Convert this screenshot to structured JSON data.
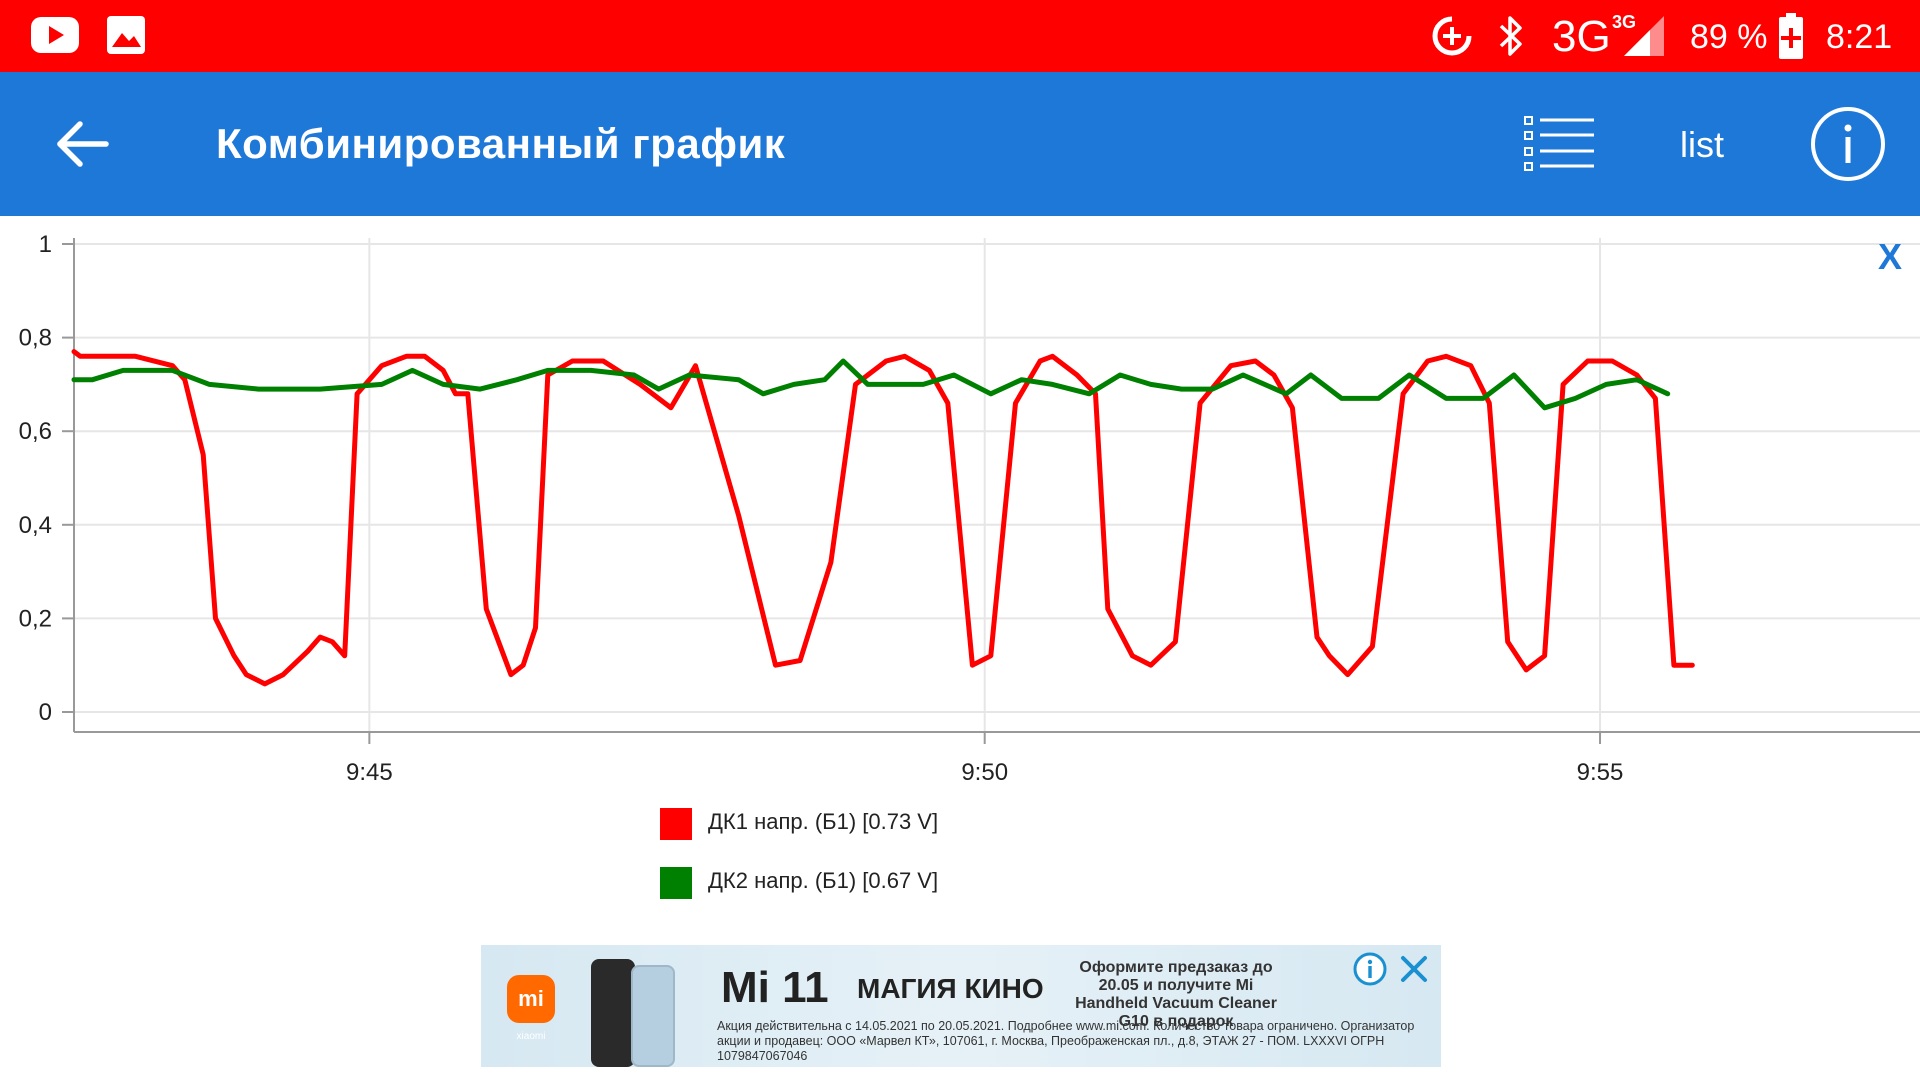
{
  "status_bar": {
    "network": "3G",
    "network_super": "3G",
    "battery_percent": "89 %",
    "time": "8:21",
    "icons": [
      "youtube-icon",
      "gallery-icon",
      "data-saver-icon",
      "bluetooth-icon",
      "signal-icon",
      "battery-charging-icon"
    ]
  },
  "app_bar": {
    "title": "Комбинированный график",
    "list_label": "list",
    "icons": [
      "back-arrow-icon",
      "list-icon",
      "info-icon"
    ]
  },
  "close_label": "X",
  "colors": {
    "status_bar": "#ff0000",
    "app_bar": "#1e78d8",
    "series1": "#ff0000",
    "series2": "#008000"
  },
  "chart_data": {
    "type": "line",
    "title": "",
    "xlabel": "",
    "ylabel": "",
    "xlim": [
      "9:42.6",
      "9:57.6"
    ],
    "ylim": [
      0,
      1
    ],
    "yticks": [
      "0",
      "0,2",
      "0,4",
      "0,6",
      "0,8",
      "1"
    ],
    "xticks": [
      "9:45",
      "9:50",
      "9:55"
    ],
    "grid": true,
    "legend_position": "bottom",
    "series": [
      {
        "name": "ДК1 напр. (Б1) [0.73 V]",
        "color": "#ff0000",
        "points": [
          [
            "9:42.6",
            0.77
          ],
          [
            "9:42.65",
            0.76
          ],
          [
            "9:43.1",
            0.76
          ],
          [
            "9:43.4",
            0.74
          ],
          [
            "9:43.5",
            0.71
          ],
          [
            "9:43.65",
            0.55
          ],
          [
            "9:43.75",
            0.2
          ],
          [
            "9:43.9",
            0.12
          ],
          [
            "9:44.0",
            0.08
          ],
          [
            "9:44.15",
            0.06
          ],
          [
            "9:44.3",
            0.08
          ],
          [
            "9:44.5",
            0.13
          ],
          [
            "9:44.6",
            0.16
          ],
          [
            "9:44.7",
            0.15
          ],
          [
            "9:44.8",
            0.12
          ],
          [
            "9:44.9",
            0.68
          ],
          [
            "9:45.1",
            0.74
          ],
          [
            "9:45.3",
            0.76
          ],
          [
            "9:45.45",
            0.76
          ],
          [
            "9:45.6",
            0.73
          ],
          [
            "9:45.7",
            0.68
          ],
          [
            "9:45.8",
            0.68
          ],
          [
            "9:45.95",
            0.22
          ],
          [
            "9:46.15",
            0.08
          ],
          [
            "9:46.25",
            0.1
          ],
          [
            "9:46.35",
            0.18
          ],
          [
            "9:46.45",
            0.72
          ],
          [
            "9:46.65",
            0.75
          ],
          [
            "9:46.9",
            0.75
          ],
          [
            "9:47.2",
            0.7
          ],
          [
            "9:47.45",
            0.65
          ],
          [
            "9:47.65",
            0.74
          ],
          [
            "9:48.0",
            0.42
          ],
          [
            "9:48.3",
            0.1
          ],
          [
            "9:48.5",
            0.11
          ],
          [
            "9:48.75",
            0.32
          ],
          [
            "9:48.95",
            0.7
          ],
          [
            "9:49.2",
            0.75
          ],
          [
            "9:49.35",
            0.76
          ],
          [
            "9:49.55",
            0.73
          ],
          [
            "9:49.7",
            0.66
          ],
          [
            "9:49.9",
            0.1
          ],
          [
            "9:50.05",
            0.12
          ],
          [
            "9:50.25",
            0.66
          ],
          [
            "9:50.45",
            0.75
          ],
          [
            "9:50.55",
            0.76
          ],
          [
            "9:50.75",
            0.72
          ],
          [
            "9:50.9",
            0.68
          ],
          [
            "9:51.0",
            0.22
          ],
          [
            "9:51.2",
            0.12
          ],
          [
            "9:51.35",
            0.1
          ],
          [
            "9:51.55",
            0.15
          ],
          [
            "9:51.75",
            0.66
          ],
          [
            "9:52.0",
            0.74
          ],
          [
            "9:52.2",
            0.75
          ],
          [
            "9:52.35",
            0.72
          ],
          [
            "9:52.5",
            0.65
          ],
          [
            "9:52.7",
            0.16
          ],
          [
            "9:52.8",
            0.12
          ],
          [
            "9:52.95",
            0.08
          ],
          [
            "9:53.15",
            0.14
          ],
          [
            "9:53.4",
            0.68
          ],
          [
            "9:53.6",
            0.75
          ],
          [
            "9:53.75",
            0.76
          ],
          [
            "9:53.95",
            0.74
          ],
          [
            "9:54.1",
            0.66
          ],
          [
            "9:54.25",
            0.15
          ],
          [
            "9:54.4",
            0.09
          ],
          [
            "9:54.55",
            0.12
          ],
          [
            "9:54.7",
            0.7
          ],
          [
            "9:54.9",
            0.75
          ],
          [
            "9:55.1",
            0.75
          ],
          [
            "9:55.3",
            0.72
          ],
          [
            "9:55.45",
            0.67
          ],
          [
            "9:55.6",
            0.1
          ],
          [
            "9:55.75",
            0.1
          ]
        ]
      },
      {
        "name": "ДК2 напр. (Б1) [0.67 V]",
        "color": "#008000",
        "points": [
          [
            "9:42.6",
            0.71
          ],
          [
            "9:42.75",
            0.71
          ],
          [
            "9:43.0",
            0.73
          ],
          [
            "9:43.4",
            0.73
          ],
          [
            "9:43.7",
            0.7
          ],
          [
            "9:44.1",
            0.69
          ],
          [
            "9:44.6",
            0.69
          ],
          [
            "9:45.1",
            0.7
          ],
          [
            "9:45.35",
            0.73
          ],
          [
            "9:45.6",
            0.7
          ],
          [
            "9:45.9",
            0.69
          ],
          [
            "9:46.2",
            0.71
          ],
          [
            "9:46.45",
            0.73
          ],
          [
            "9:46.8",
            0.73
          ],
          [
            "9:47.15",
            0.72
          ],
          [
            "9:47.35",
            0.69
          ],
          [
            "9:47.6",
            0.72
          ],
          [
            "9:48.0",
            0.71
          ],
          [
            "9:48.2",
            0.68
          ],
          [
            "9:48.45",
            0.7
          ],
          [
            "9:48.7",
            0.71
          ],
          [
            "9:48.85",
            0.75
          ],
          [
            "9:49.05",
            0.7
          ],
          [
            "9:49.3",
            0.7
          ],
          [
            "9:49.5",
            0.7
          ],
          [
            "9:49.75",
            0.72
          ],
          [
            "9:50.05",
            0.68
          ],
          [
            "9:50.3",
            0.71
          ],
          [
            "9:50.55",
            0.7
          ],
          [
            "9:50.85",
            0.68
          ],
          [
            "9:51.1",
            0.72
          ],
          [
            "9:51.35",
            0.7
          ],
          [
            "9:51.6",
            0.69
          ],
          [
            "9:51.85",
            0.69
          ],
          [
            "9:52.1",
            0.72
          ],
          [
            "9:52.45",
            0.68
          ],
          [
            "9:52.65",
            0.72
          ],
          [
            "9:52.9",
            0.67
          ],
          [
            "9:53.2",
            0.67
          ],
          [
            "9:53.45",
            0.72
          ],
          [
            "9:53.75",
            0.67
          ],
          [
            "9:54.05",
            0.67
          ],
          [
            "9:54.3",
            0.72
          ],
          [
            "9:54.55",
            0.65
          ],
          [
            "9:54.8",
            0.67
          ],
          [
            "9:55.05",
            0.7
          ],
          [
            "9:55.3",
            0.71
          ],
          [
            "9:55.55",
            0.68
          ]
        ]
      }
    ]
  },
  "ad": {
    "brand": "mi",
    "brand_sub": "xiaomi",
    "headline": "Mi 11",
    "tagline": "МАГИЯ КИНО",
    "offer": "Оформите предзаказ до 20.05 и получите Mi Handheld Vacuum Cleaner G10 в подарок",
    "disclaimer": "Акция действительна с 14.05.2021 по 20.05.2021. Подробнее www.mi.com. Количество товара ограничено. Организатор акции и продавец: ООО «Марвел КТ», 107061, г. Москва, Преображенская пл., д.8, ЭТАЖ 27 - ПОМ. LXXXVI ОГРН 1079847067046",
    "icons": [
      "ad-info-icon",
      "ad-close-icon"
    ]
  }
}
